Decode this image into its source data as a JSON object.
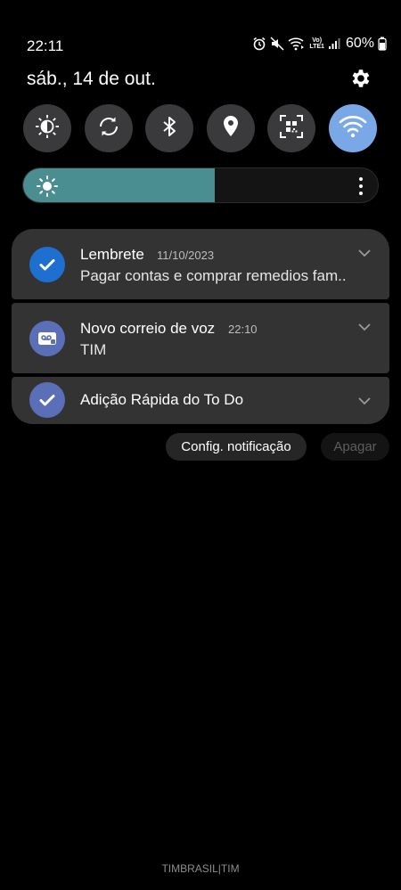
{
  "status_bar": {
    "time": "22:11",
    "volte_top": "Vo)",
    "volte_bottom": "LTE1",
    "battery_percent": "60%",
    "icons": [
      "alarm-icon",
      "mute-icon",
      "wifi-call-icon",
      "volte-icon",
      "signal-icon",
      "battery-icon"
    ]
  },
  "header": {
    "date": "sáb., 14 de out.",
    "settings_icon": "gear-icon"
  },
  "quick_settings": [
    {
      "icon": "eye-comfort-icon",
      "active": false
    },
    {
      "icon": "auto-rotate-icon",
      "active": false
    },
    {
      "icon": "bluetooth-icon",
      "active": false
    },
    {
      "icon": "location-icon",
      "active": false
    },
    {
      "icon": "qr-scanner-icon",
      "active": false
    },
    {
      "icon": "wifi-icon",
      "active": true
    }
  ],
  "brightness": {
    "level": 0.54,
    "fill_color": "#4a8e92"
  },
  "notifications": [
    {
      "app": "Lembrete",
      "time": "11/10/2023",
      "body": "Pagar contas e comprar remedios fam..",
      "icon_color": "#1e6fd0",
      "icon": "check-icon"
    },
    {
      "app": "Novo correio de voz",
      "time": "22:10",
      "body": "TIM",
      "icon_color": "#5b6eb8",
      "icon": "voicemail-icon"
    },
    {
      "app": "Adição Rápida do To Do",
      "icon_color": "#5b6eb8",
      "icon": "check-icon"
    }
  ],
  "actions": {
    "config_label": "Config. notificação",
    "clear_label": "Apagar"
  },
  "carrier": "TIMBRASIL|TIM",
  "colors": {
    "background": "#000000",
    "card": "#333333",
    "active_tile": "#7aa8e6"
  }
}
